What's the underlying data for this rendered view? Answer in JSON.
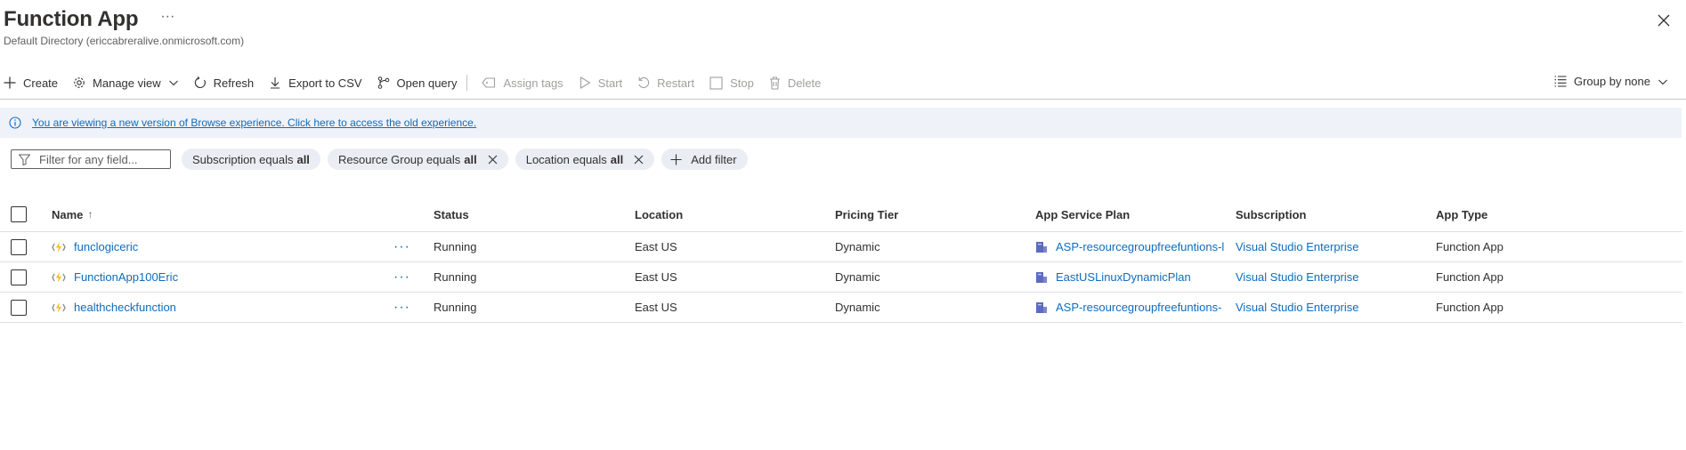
{
  "header": {
    "title": "Function App",
    "more": "···",
    "subtitle": "Default Directory (ericcabreralive.onmicrosoft.com)"
  },
  "toolbar": {
    "create": "Create",
    "manage_view": "Manage view",
    "refresh": "Refresh",
    "export_csv": "Export to CSV",
    "open_query": "Open query",
    "assign_tags": "Assign tags",
    "start": "Start",
    "restart": "Restart",
    "stop": "Stop",
    "delete": "Delete",
    "group_by": "Group by none"
  },
  "banner": {
    "text": "You are viewing a new version of Browse experience. Click here to access the old experience."
  },
  "filters": {
    "search_placeholder": "Filter for any field...",
    "pills": [
      {
        "label": "Subscription equals",
        "value": "all"
      },
      {
        "label": "Resource Group equals",
        "value": "all"
      },
      {
        "label": "Location equals",
        "value": "all"
      }
    ],
    "add_filter": "Add filter"
  },
  "table": {
    "columns": {
      "name": "Name",
      "name_sort": "↑",
      "status": "Status",
      "location": "Location",
      "pricing_tier": "Pricing Tier",
      "app_service_plan": "App Service Plan",
      "subscription": "Subscription",
      "app_type": "App Type"
    },
    "row_more": "···",
    "rows": [
      {
        "name": "funclogiceric",
        "status": "Running",
        "location": "East US",
        "pricing_tier": "Dynamic",
        "app_service_plan": "ASP-resourcegroupfreefuntions-l",
        "subscription": "Visual Studio Enterprise",
        "app_type": "Function App"
      },
      {
        "name": "FunctionApp100Eric",
        "status": "Running",
        "location": "East US",
        "pricing_tier": "Dynamic",
        "app_service_plan": "EastUSLinuxDynamicPlan",
        "subscription": "Visual Studio Enterprise",
        "app_type": "Function App"
      },
      {
        "name": "healthcheckfunction",
        "status": "Running",
        "location": "East US",
        "pricing_tier": "Dynamic",
        "app_service_plan": "ASP-resourcegroupfreefuntions-",
        "subscription": "Visual Studio Enterprise",
        "app_type": "Function App"
      }
    ]
  },
  "colors": {
    "link": "#0f6cbd",
    "banner_bg": "#eff3f9",
    "pill_bg": "#eaeef4",
    "function_icon": "#ffb900"
  }
}
